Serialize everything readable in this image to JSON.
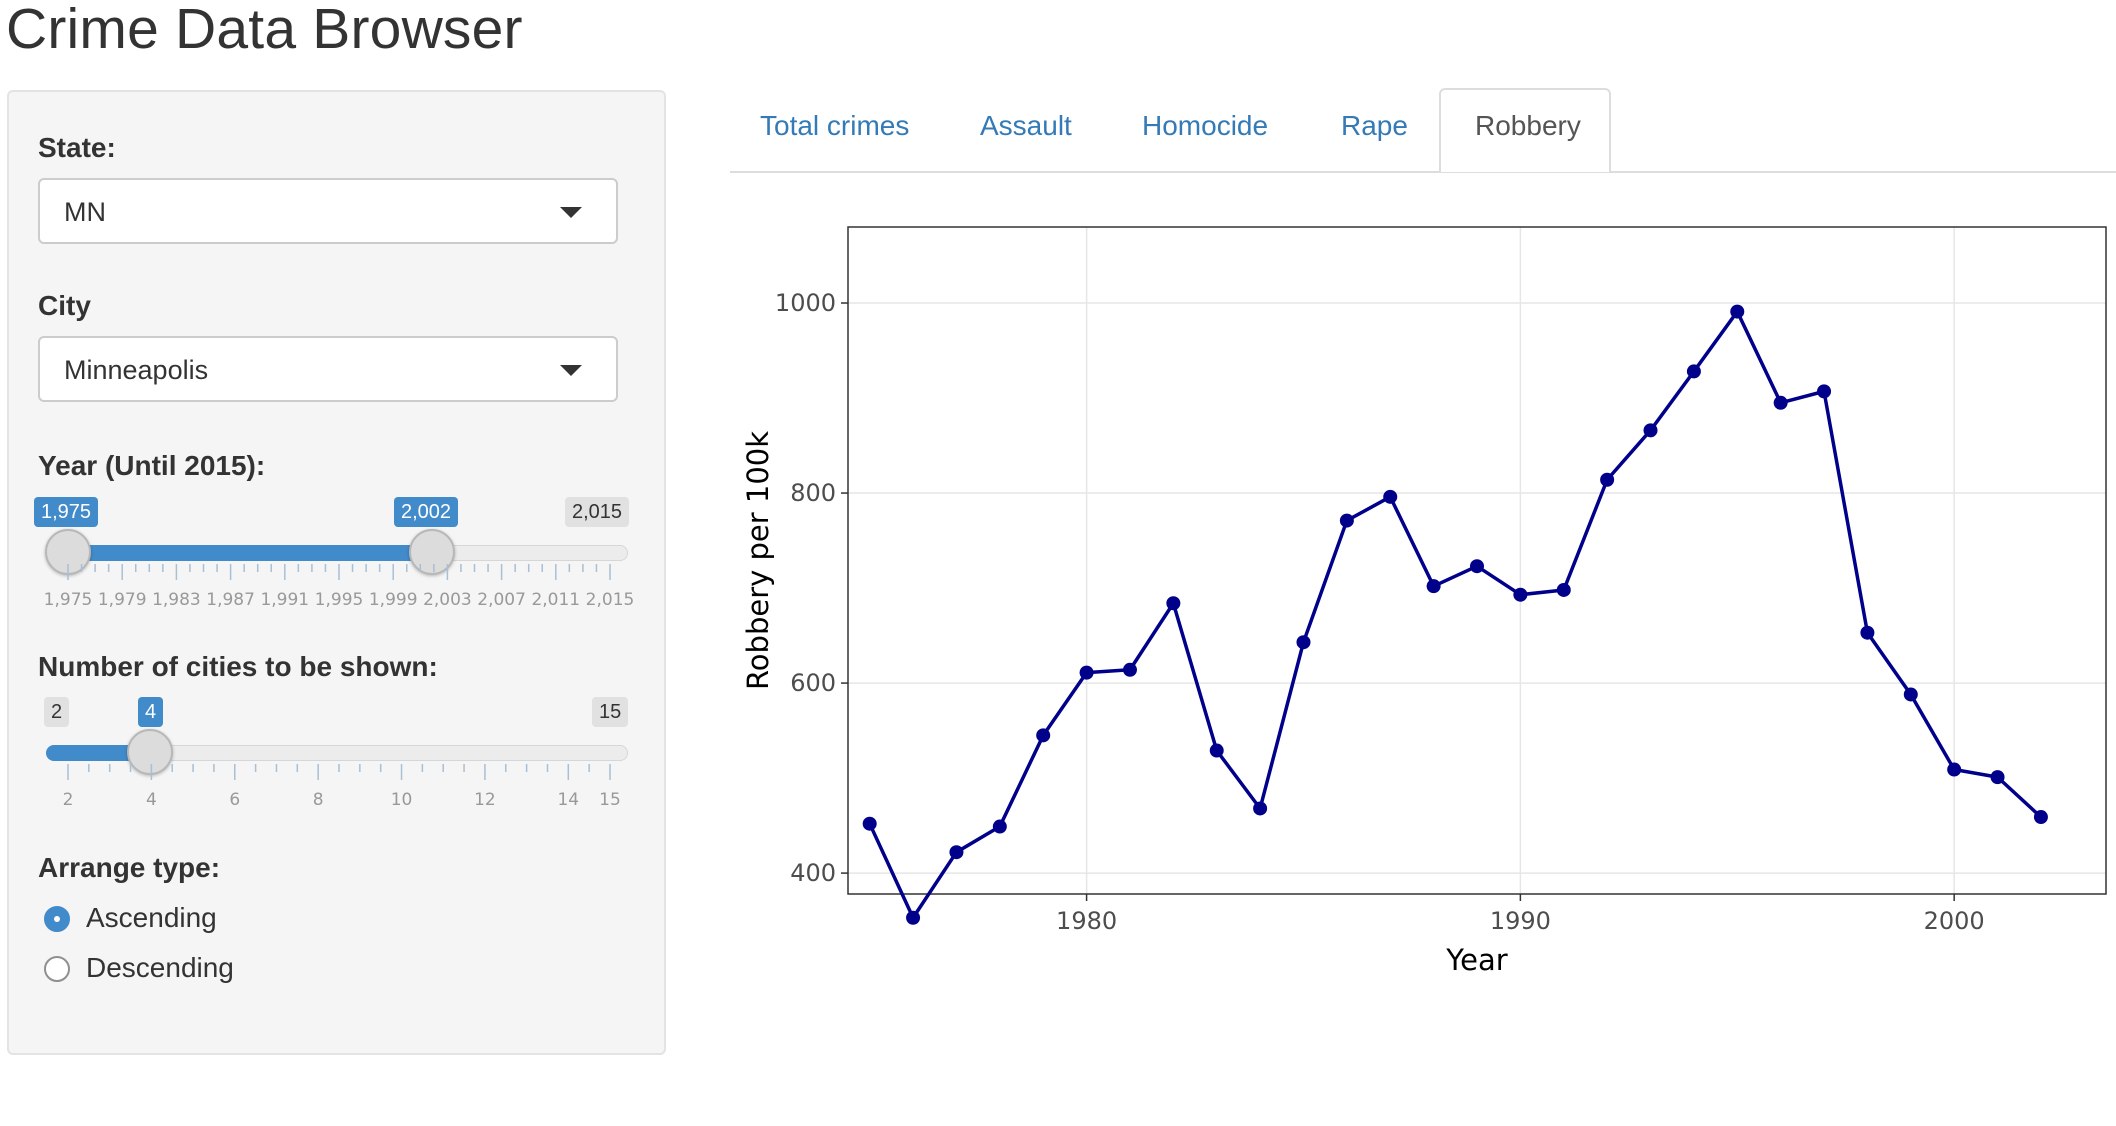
{
  "app": {
    "title": "Crime Data Browser"
  },
  "sidebar": {
    "state": {
      "label": "State:",
      "value": "MN"
    },
    "city": {
      "label": "City",
      "value": "Minneapolis"
    },
    "year_slider": {
      "label": "Year (Until 2015):",
      "min": 1975,
      "max": 2015,
      "from": 1975,
      "to": 2002,
      "from_label": "1,975",
      "to_label": "2,002",
      "min_label": "1,975",
      "max_label": "2,015",
      "tick_labels": [
        "1,975",
        "1,979",
        "1,983",
        "1,987",
        "1,991",
        "1,995",
        "1,999",
        "2,003",
        "2,007",
        "2,011",
        "2,015"
      ]
    },
    "cities_slider": {
      "label": "Number of cities to be shown:",
      "min": 2,
      "max": 15,
      "value": 4,
      "value_label": "4",
      "min_label": "2",
      "max_label": "15",
      "tick_labels": [
        "2",
        "4",
        "6",
        "8",
        "10",
        "12",
        "14",
        "15"
      ]
    },
    "arrange": {
      "label": "Arrange type:",
      "options": [
        {
          "label": "Ascending",
          "checked": true
        },
        {
          "label": "Descending",
          "checked": false
        }
      ]
    }
  },
  "tabs": [
    {
      "label": "Total crimes",
      "active": false
    },
    {
      "label": "Assault",
      "active": false
    },
    {
      "label": "Homocide",
      "active": false
    },
    {
      "label": "Rape",
      "active": false
    },
    {
      "label": "Robbery",
      "active": true
    }
  ],
  "colors": {
    "accent": "#428bca",
    "link": "#337ab7",
    "series": "#00008b"
  },
  "chart_data": {
    "type": "line",
    "title": "",
    "xlabel": "Year",
    "ylabel": "Robbery per 100k",
    "xlim": [
      1974.5,
      2003.5
    ],
    "ylim": [
      378,
      1080
    ],
    "x_ticks": [
      1980,
      1990,
      2000
    ],
    "y_ticks": [
      400,
      600,
      800,
      1000
    ],
    "grid": true,
    "series": [
      {
        "x": [
          1975,
          1976,
          1977,
          1978,
          1979,
          1980,
          1981,
          1982,
          1983,
          1984,
          1985,
          1986,
          1987,
          1988,
          1989,
          1990,
          1991,
          1992,
          1993,
          1994,
          1995,
          1996,
          1997,
          1998,
          1999,
          2000,
          2001,
          2002
        ],
        "values": [
          452,
          353,
          422,
          449,
          545,
          611,
          614,
          684,
          529,
          468,
          643,
          771,
          796,
          702,
          723,
          693,
          698,
          814,
          866,
          928,
          991,
          895,
          907,
          653,
          588,
          509,
          501,
          459
        ]
      }
    ]
  }
}
